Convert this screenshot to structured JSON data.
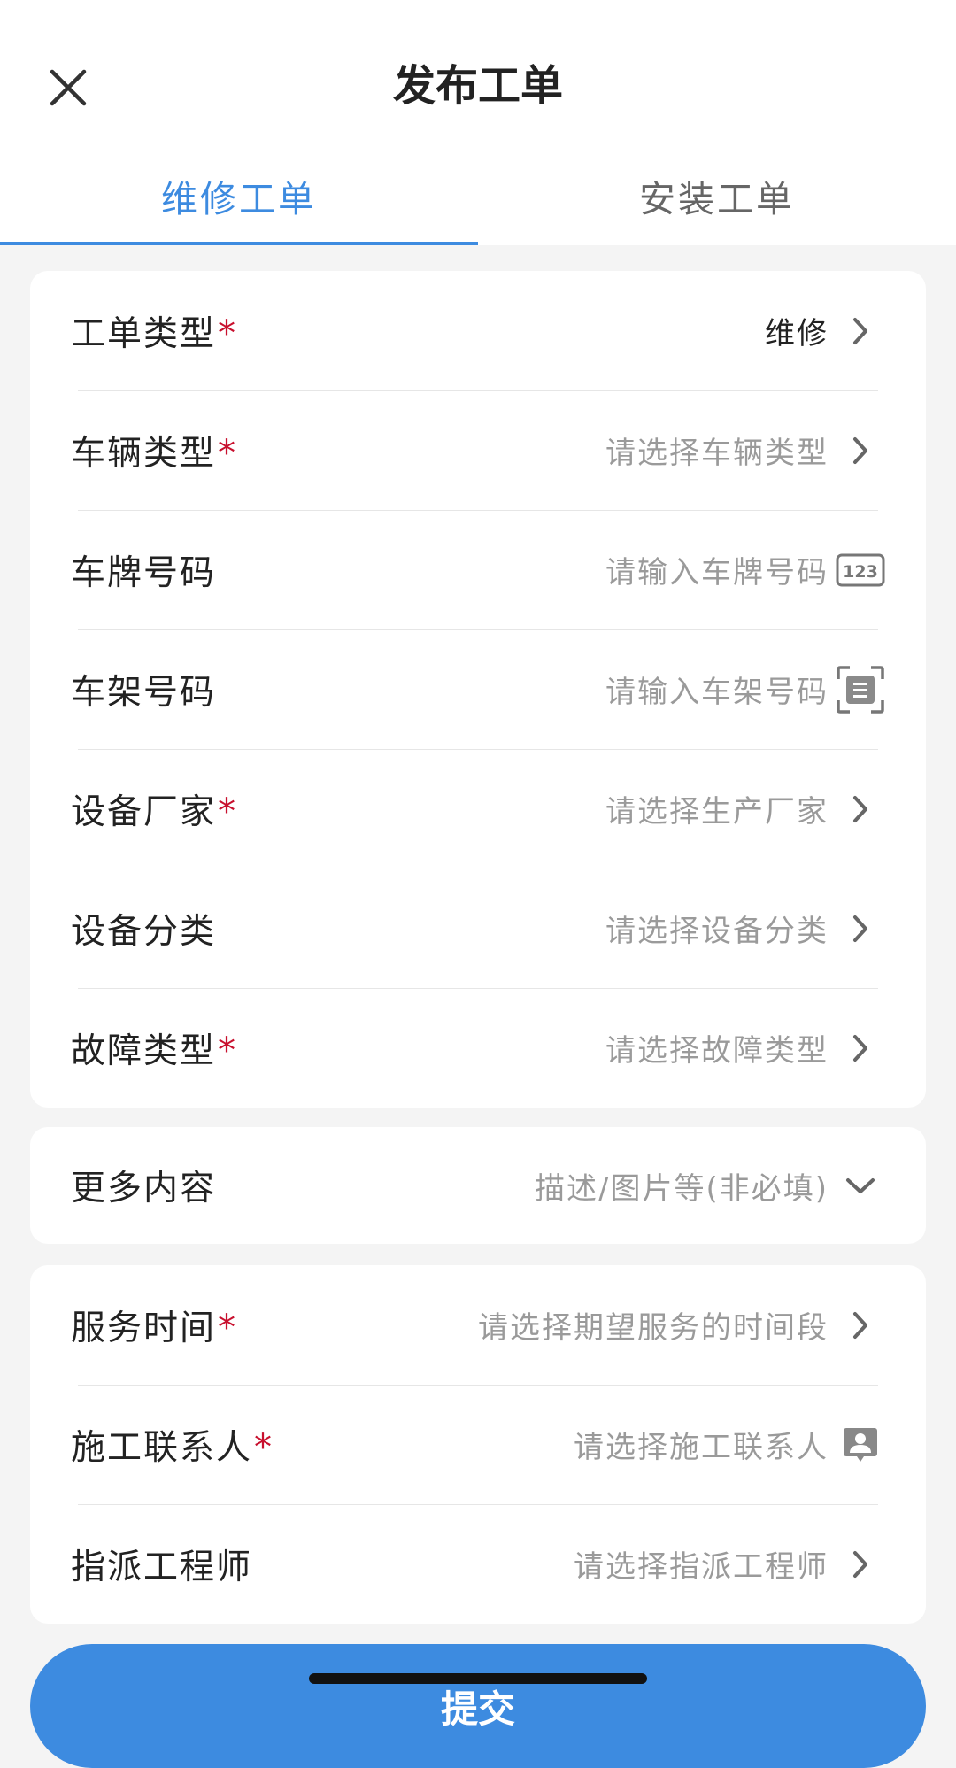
{
  "header": {
    "title": "发布工单"
  },
  "tabs": [
    {
      "label": "维修工单",
      "active": true
    },
    {
      "label": "安装工单",
      "active": false
    }
  ],
  "form_main": [
    {
      "label": "工单类型",
      "required": "*",
      "value": "维修"
    },
    {
      "label": "车辆类型",
      "required": "*",
      "value": "请选择车辆类型"
    },
    {
      "label": "车牌号码",
      "required": "",
      "value": "请输入车牌号码",
      "icon": "keypad-123-icon"
    },
    {
      "label": "车架号码",
      "required": "",
      "value": "请输入车架号码",
      "icon": "scan-document-icon"
    },
    {
      "label": "设备厂家",
      "required": "*",
      "value": "请选择生产厂家"
    },
    {
      "label": "设备分类",
      "required": "",
      "value": "请选择设备分类"
    },
    {
      "label": "故障类型",
      "required": "*",
      "value": "请选择故障类型"
    }
  ],
  "more": {
    "label": "更多内容",
    "value": "描述/图片等(非必填)"
  },
  "form_service": [
    {
      "label": "服务时间",
      "required": "*",
      "value": "请选择期望服务的时间段"
    },
    {
      "label": "施工联系人",
      "required": "*",
      "value": "请选择施工联系人",
      "icon": "contact-card-icon"
    },
    {
      "label": "指派工程师",
      "required": "",
      "value": "请选择指派工程师"
    }
  ],
  "submit": {
    "label": "提交"
  },
  "colors": {
    "accent": "#3d8be0",
    "required": "#c8102e",
    "placeholder": "#9a9a9a"
  }
}
